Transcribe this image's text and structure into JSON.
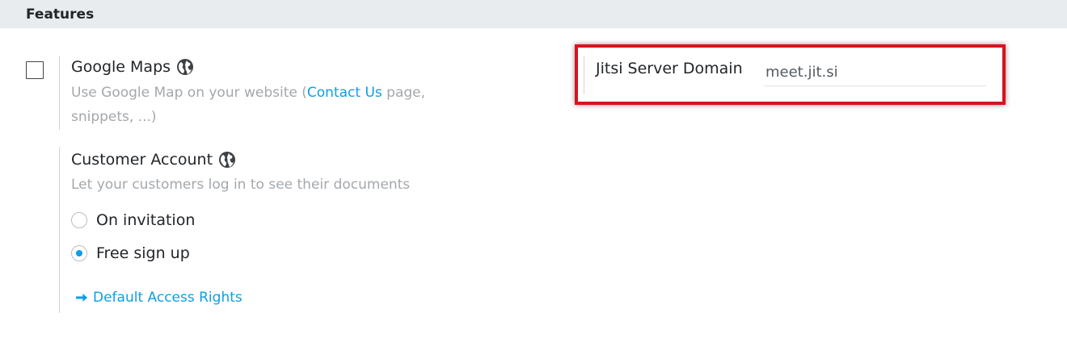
{
  "section": {
    "title": "Features"
  },
  "google_maps": {
    "title": "Google Maps",
    "checked": false,
    "desc_prefix": "Use Google Map on your website (",
    "desc_link": "Contact Us",
    "desc_suffix_1": " page,",
    "desc_line2": "snippets, ...)"
  },
  "customer_account": {
    "title": "Customer Account",
    "desc": "Let your customers log in to see their documents",
    "options": [
      {
        "label": "On invitation",
        "selected": false
      },
      {
        "label": "Free sign up",
        "selected": true
      }
    ],
    "link": "Default Access Rights"
  },
  "jitsi": {
    "label": "Jitsi Server Domain",
    "value": "meet.jit.si"
  },
  "colors": {
    "accent": "#0d9ee5",
    "highlight": "#d6141d",
    "header_bg": "#e9ecef",
    "muted_text": "#a3a8ad"
  },
  "icons": {
    "settings_scope": "globe-icon",
    "link_arrow": "arrow-right-icon"
  }
}
